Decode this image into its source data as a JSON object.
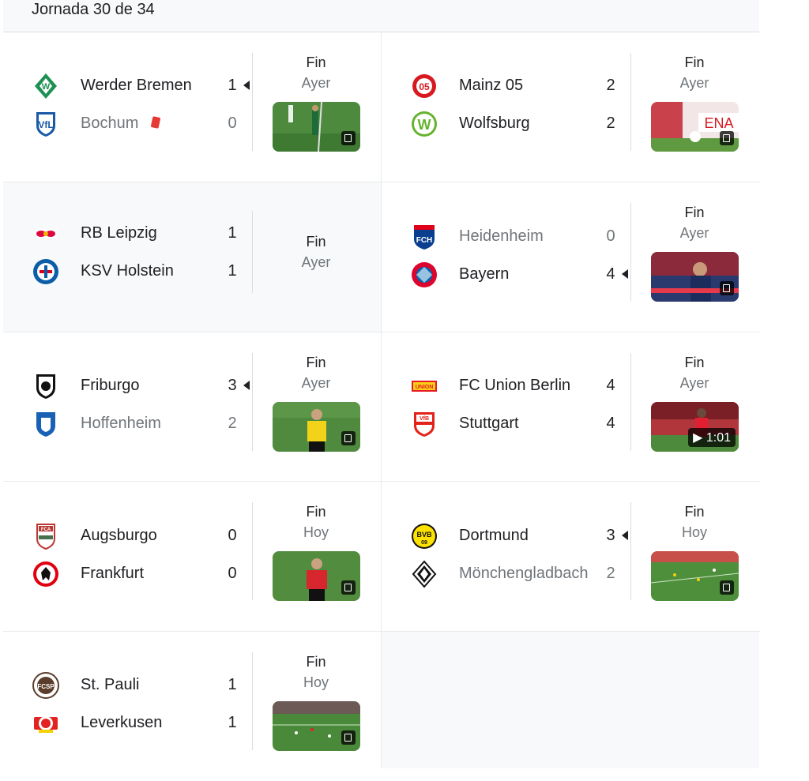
{
  "header": {
    "title": "Jornada 30 de 34"
  },
  "matches": [
    {
      "status": "Fin",
      "day": "Ayer",
      "home": {
        "name": "Werder Bremen",
        "score": "1"
      },
      "away": {
        "name": "Bochum",
        "score": "0"
      }
    },
    {
      "status": "Fin",
      "day": "Ayer",
      "home": {
        "name": "Mainz 05",
        "score": "2"
      },
      "away": {
        "name": "Wolfsburg",
        "score": "2"
      }
    },
    {
      "status": "Fin",
      "day": "Ayer",
      "home": {
        "name": "RB Leipzig",
        "score": "1"
      },
      "away": {
        "name": "KSV Holstein",
        "score": "1"
      }
    },
    {
      "status": "Fin",
      "day": "Ayer",
      "home": {
        "name": "Heidenheim",
        "score": "0"
      },
      "away": {
        "name": "Bayern",
        "score": "4"
      }
    },
    {
      "status": "Fin",
      "day": "Ayer",
      "home": {
        "name": "Friburgo",
        "score": "3"
      },
      "away": {
        "name": "Hoffenheim",
        "score": "2"
      }
    },
    {
      "status": "Fin",
      "day": "Ayer",
      "home": {
        "name": "FC Union Berlin",
        "score": "4"
      },
      "away": {
        "name": "Stuttgart",
        "score": "4"
      },
      "video_duration": "1:01"
    },
    {
      "status": "Fin",
      "day": "Hoy",
      "home": {
        "name": "Augsburgo",
        "score": "0"
      },
      "away": {
        "name": "Frankfurt",
        "score": "0"
      }
    },
    {
      "status": "Fin",
      "day": "Hoy",
      "home": {
        "name": "Dortmund",
        "score": "3"
      },
      "away": {
        "name": "Mönchengladbach",
        "score": "2"
      }
    },
    {
      "status": "Fin",
      "day": "Hoy",
      "home": {
        "name": "St. Pauli",
        "score": "1"
      },
      "away": {
        "name": "Leverkusen",
        "score": "1"
      }
    }
  ],
  "icons": {
    "red_card": "red-card-icon",
    "winner_marker": "winner-arrow-icon",
    "video": "video-icon"
  },
  "colors": {
    "red_card": "#e53935",
    "muted_text": "#70757a",
    "text": "#202124"
  }
}
